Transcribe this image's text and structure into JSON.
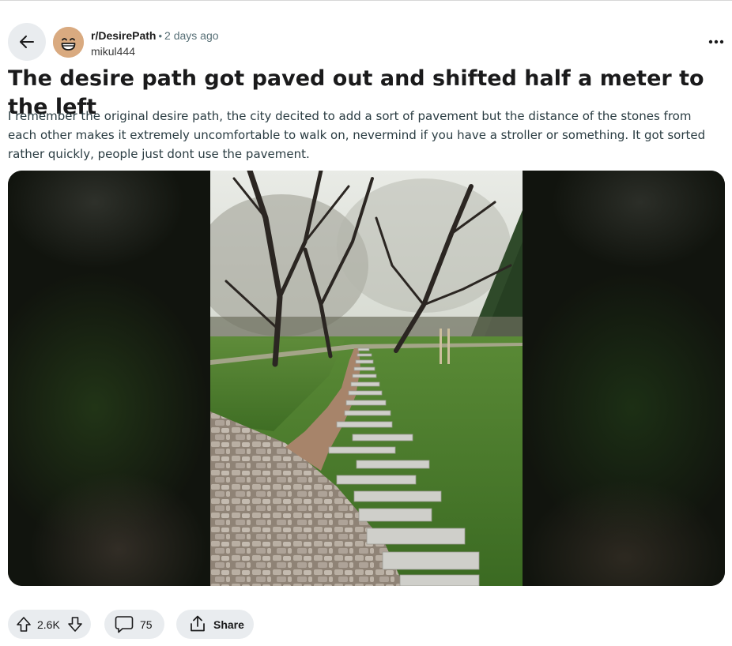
{
  "post": {
    "subreddit": "r/DesirePath",
    "separator": "•",
    "time_ago": "2 days ago",
    "author": "mikul444",
    "title": "The desire path got paved out and shifted half a meter to the left",
    "body": "I remember the original desire path, the city decited to add a sort of pavement but the distance of the stones from each other makes it extremely uncomfortable to walk on, nevermind if you have a stroller or something. It got sorted rather quickly, people just dont use the pavement."
  },
  "actions": {
    "vote_count": "2.6K",
    "comment_count": "75",
    "share_label": "Share"
  },
  "icons": {
    "back": "arrow-left-icon",
    "more": "more-horizontal-icon",
    "upvote": "arrow-up-icon",
    "downvote": "arrow-down-icon",
    "comment": "speech-bubble-icon",
    "share": "share-upload-icon"
  },
  "colors": {
    "pill_bg": "#e9ecef",
    "avatar_bg": "#d7a87f",
    "meta_gray": "#576f76"
  }
}
